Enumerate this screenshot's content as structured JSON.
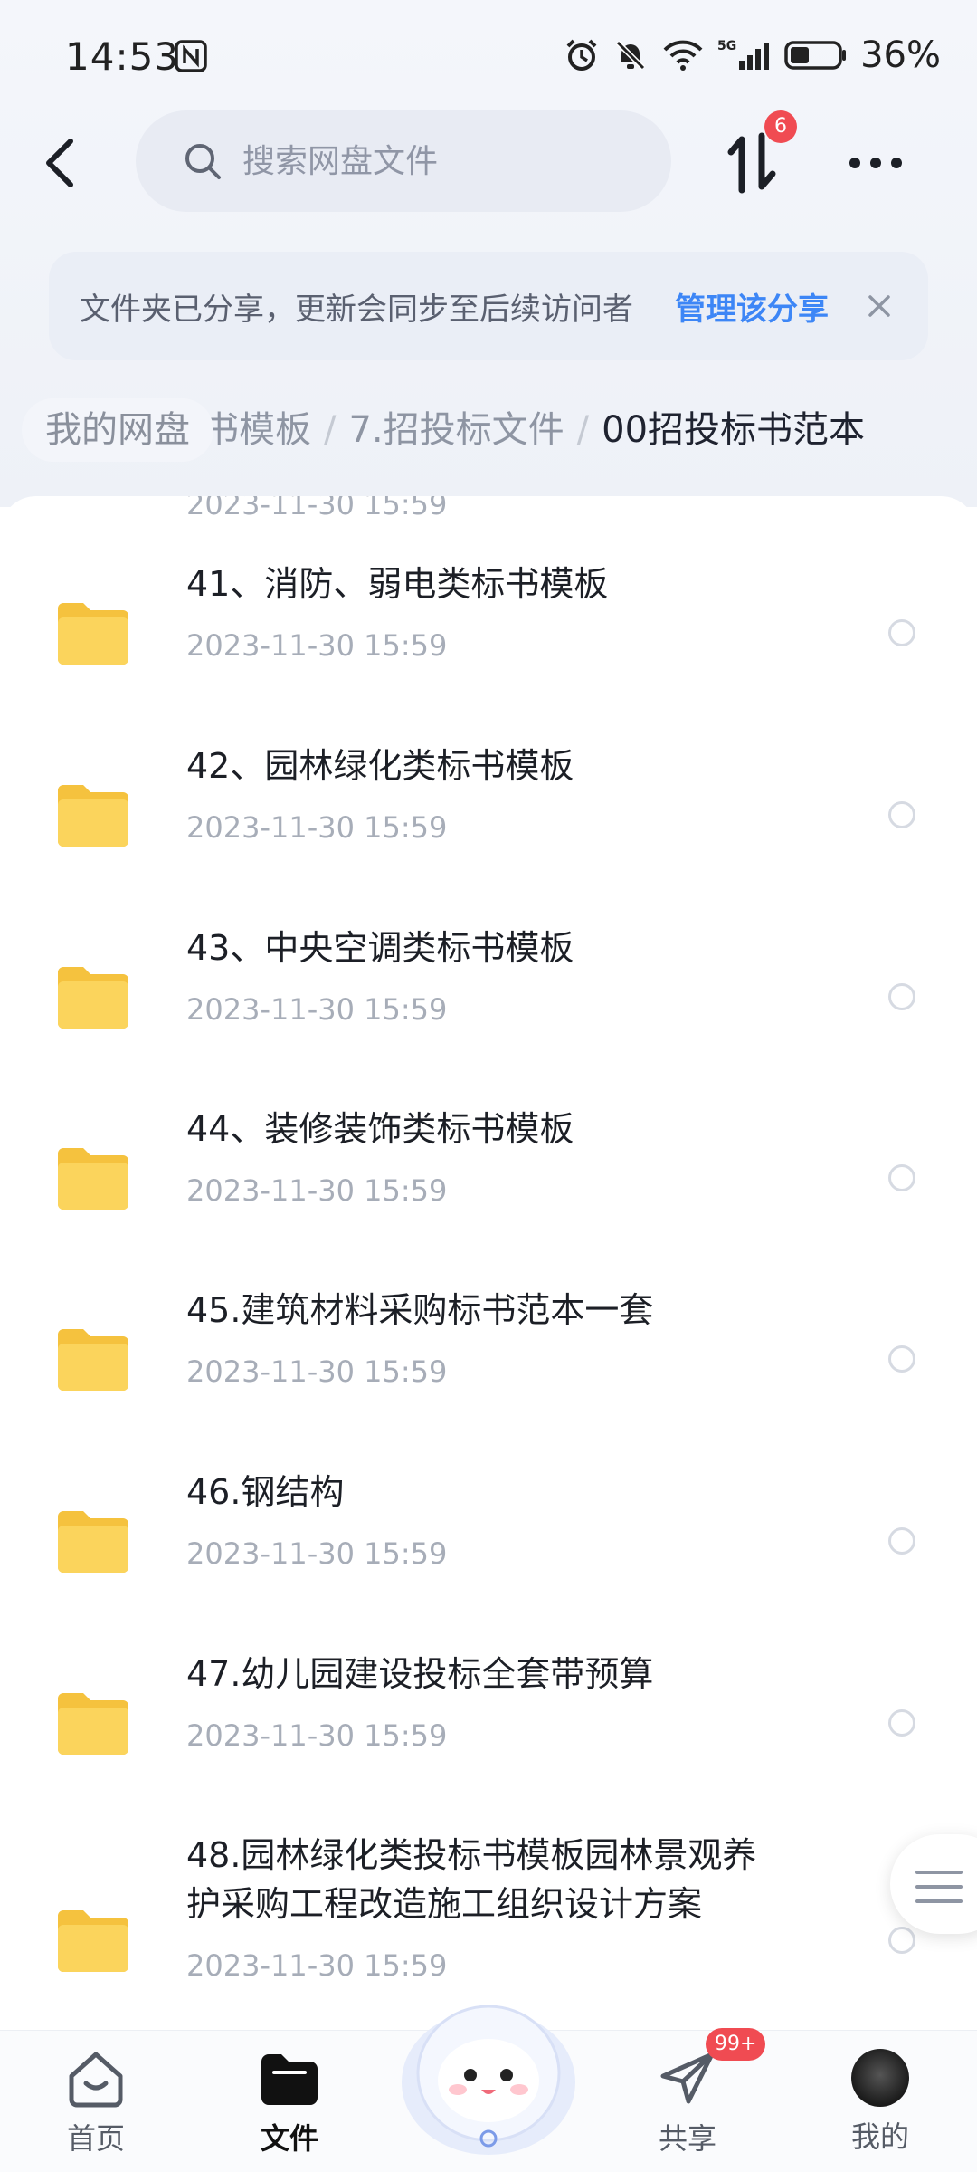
{
  "status_bar": {
    "time": "14:53",
    "battery": "36%",
    "network": "5G"
  },
  "header": {
    "search_placeholder": "搜索网盘文件",
    "transfer_badge": "6"
  },
  "notice": {
    "text": "文件夹已分享，更新会同步至后续访问者",
    "link": "管理该分享"
  },
  "breadcrumb": {
    "home": "我的网盘",
    "items": [
      "标书模板",
      "7.招投标文件"
    ],
    "current": "00招投标书范本"
  },
  "list": {
    "partial_item_date": "2023-11-30  15:59",
    "items": [
      {
        "name": "41、消防、弱电类标书模板",
        "date": "2023-11-30  15:59"
      },
      {
        "name": "42、园林绿化类标书模板",
        "date": "2023-11-30  15:59"
      },
      {
        "name": "43、中央空调类标书模板",
        "date": "2023-11-30  15:59"
      },
      {
        "name": "44、装修装饰类标书模板",
        "date": "2023-11-30  15:59"
      },
      {
        "name": "45.建筑材料采购标书范本一套",
        "date": "2023-11-30  15:59"
      },
      {
        "name": "46.钢结构",
        "date": "2023-11-30  15:59"
      },
      {
        "name": "47.幼儿园建设投标全套带预算",
        "date": "2023-11-30  15:59"
      },
      {
        "name_line1": "48.园林绿化类投标书模板园林景观养",
        "name_line2": "护采购工程改造施工组织设计方案",
        "date": "2023-11-30  15:59"
      }
    ]
  },
  "bottom_nav": {
    "home": "首页",
    "files": "文件",
    "share": "共享",
    "share_badge": "99+",
    "mine": "我的"
  },
  "colors": {
    "accent": "#3d86f6",
    "badge": "#f04b52",
    "folder": "#f7c94a"
  }
}
